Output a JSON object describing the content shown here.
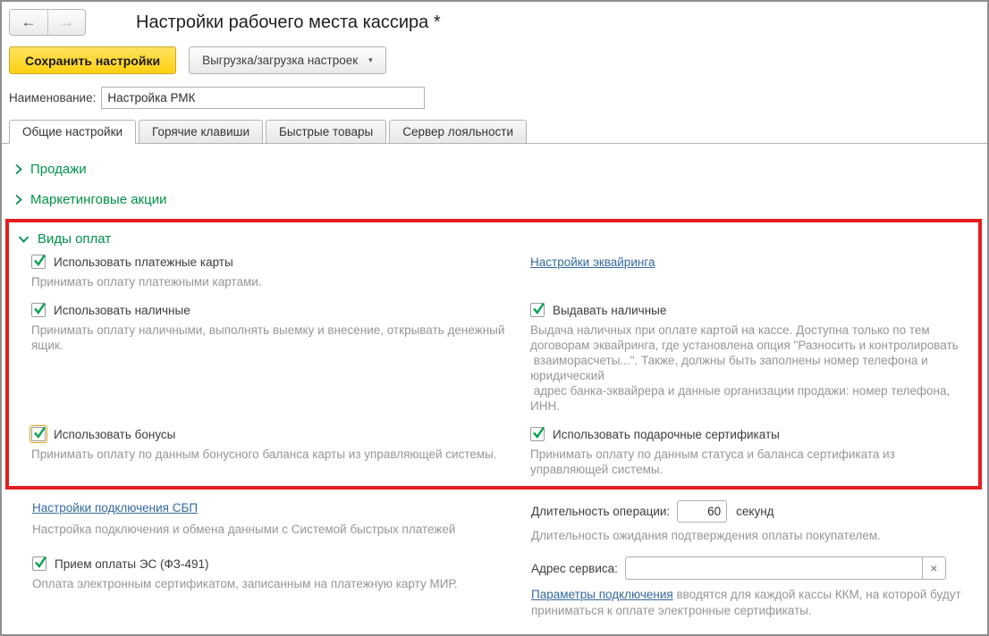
{
  "window": {
    "title": "Настройки рабочего места кассира *"
  },
  "icons": {
    "back": "←",
    "forward": "→",
    "caret": "▾",
    "clear": "×"
  },
  "toolbar": {
    "save_label": "Сохранить настройки",
    "export_label": "Выгрузка/загрузка настроек"
  },
  "name_field": {
    "label": "Наименование:",
    "value": "Настройка РМК"
  },
  "tabs": [
    {
      "label": "Общие настройки",
      "active": true
    },
    {
      "label": "Горячие клавиши",
      "active": false
    },
    {
      "label": "Быстрые товары",
      "active": false
    },
    {
      "label": "Сервер лояльности",
      "active": false
    }
  ],
  "sections": {
    "sales": {
      "label": "Продажи",
      "collapsed": true
    },
    "marketing": {
      "label": "Маркетинговые акции",
      "collapsed": true
    }
  },
  "payments": {
    "label": "Виды оплат",
    "highlight_color": "#e31e1e",
    "accent_green": "#00914d",
    "card": {
      "label": "Использовать платежные карты",
      "checked": true,
      "desc": "Принимать оплату платежными картами."
    },
    "acquiring_link": "Настройки эквайринга",
    "cash": {
      "label": "Использовать наличные",
      "checked": true,
      "desc": "Принимать оплату наличными, выполнять выемку и внесение, открывать денежный ящик."
    },
    "cash_out": {
      "label": "Выдавать наличные",
      "checked": true,
      "desc": "Выдача наличных при оплате картой на кассе. Доступна только по тем договорам эквайринга, где установлена опция \"Разносить и контролировать\n взаиморасчеты...\". Также, должны быть заполнены номер телефона и юридический\n адрес банка-эквайрера и данные организации продажи: номер телефона, ИНН."
    },
    "bonus": {
      "label": "Использовать бонусы",
      "checked": true,
      "focused": true,
      "desc": "Принимать оплату по данным бонусного баланса карты из управляющей системы."
    },
    "gift": {
      "label": "Использовать подарочные сертификаты",
      "checked": true,
      "desc": "Принимать оплату по данным статуса и баланса сертификата из управляющей системы."
    }
  },
  "sbp": {
    "link": "Настройки подключения СБП",
    "desc": "Настройка подключения и обмена данными с Системой быстрых платежей"
  },
  "duration": {
    "label": "Длительность операции:",
    "value": "60",
    "unit": "секунд",
    "desc": "Длительность ожидания подтверждения оплаты покупателем."
  },
  "es": {
    "label": "Прием оплаты ЭС (ФЗ-491)",
    "checked": true,
    "desc": "Оплата электронным сертификатом, записанным на платежную карту МИР."
  },
  "service": {
    "label": "Адрес сервиса:",
    "value": "",
    "link": "Параметры подключения",
    "tail": " вводятся для каждой кассы ККМ, на которой будут приниматься к оплате электронные сертификаты."
  }
}
